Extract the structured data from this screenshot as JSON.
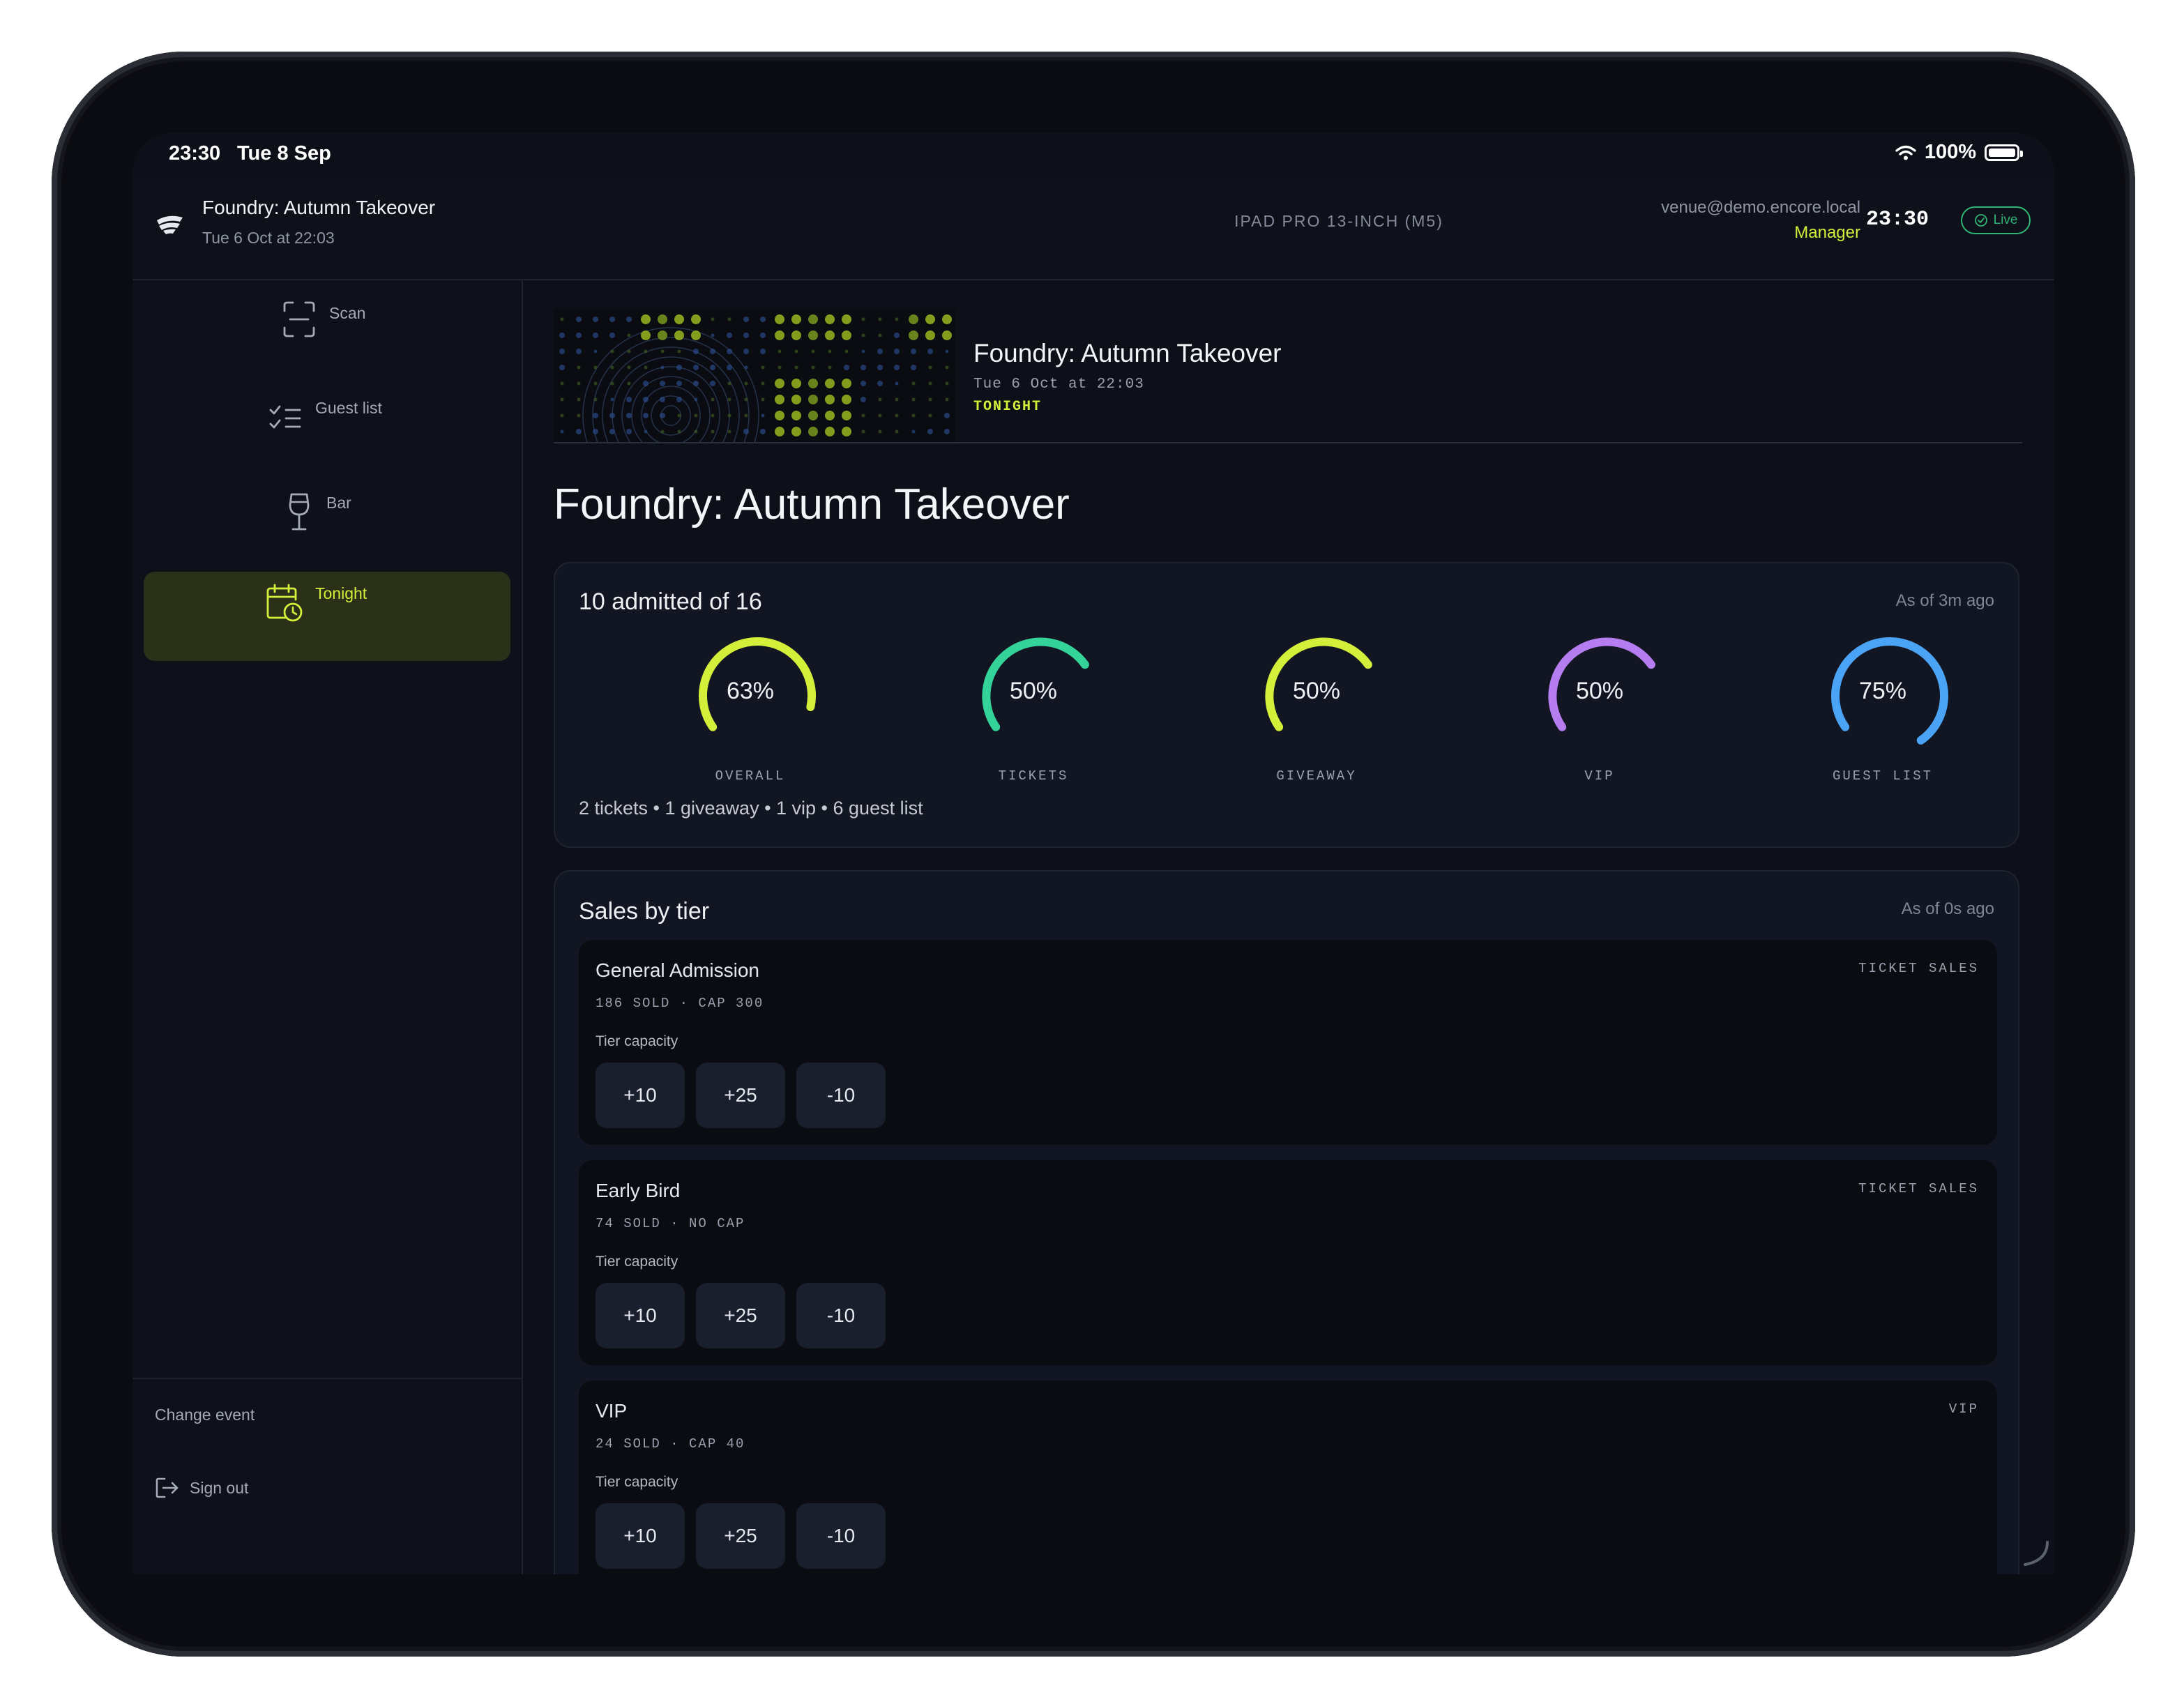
{
  "status_bar": {
    "time": "23:30",
    "date": "Tue 8 Sep",
    "battery": "100%"
  },
  "header": {
    "event_title": "Foundry: Autumn Takeover",
    "event_date": "Tue 6 Oct at 22:03",
    "device": "IPAD PRO 13-INCH (M5)",
    "user_email": "venue@demo.encore.local",
    "user_role": "Manager",
    "clock": "23:30",
    "live_label": "Live"
  },
  "sidebar": {
    "items": [
      {
        "label": "Scan",
        "icon": "scan-icon"
      },
      {
        "label": "Guest list",
        "icon": "checklist-icon"
      },
      {
        "label": "Bar",
        "icon": "wine-glass-icon"
      },
      {
        "label": "Tonight",
        "icon": "calendar-clock-icon",
        "active": true
      }
    ],
    "change_event": "Change event",
    "sign_out": "Sign out"
  },
  "banner": {
    "title": "Foundry: Autumn Takeover",
    "date": "Tue 6 Oct at 22:03",
    "tag": "TONIGHT"
  },
  "page_title": "Foundry: Autumn Takeover",
  "admissions": {
    "title": "10 admitted of 16",
    "as_of": "As of 3m ago",
    "rings": [
      {
        "label": "OVERALL",
        "percent": 63,
        "percent_text": "63%",
        "color": "#d4ef3a"
      },
      {
        "label": "TICKETS",
        "percent": 50,
        "percent_text": "50%",
        "color": "#34d399"
      },
      {
        "label": "GIVEAWAY",
        "percent": 50,
        "percent_text": "50%",
        "color": "#d4ef3a"
      },
      {
        "label": "VIP",
        "percent": 50,
        "percent_text": "50%",
        "color": "#b57df0"
      },
      {
        "label": "GUEST LIST",
        "percent": 75,
        "percent_text": "75%",
        "color": "#4aa3f5"
      }
    ],
    "breakdown": "2 tickets • 1 giveaway • 1 vip • 6 guest list"
  },
  "sales": {
    "title": "Sales by tier",
    "as_of": "As of 0s ago",
    "tiers": [
      {
        "name": "General Admission",
        "meta": "186 SOLD · CAP 300",
        "type": "TICKET SALES",
        "capacity_label": "Tier capacity",
        "buttons": [
          "+10",
          "+25",
          "-10"
        ]
      },
      {
        "name": "Early Bird",
        "meta": "74 SOLD · NO CAP",
        "type": "TICKET SALES",
        "capacity_label": "Tier capacity",
        "buttons": [
          "+10",
          "+25",
          "-10"
        ]
      },
      {
        "name": "VIP",
        "meta": "24 SOLD · CAP 40",
        "type": "VIP",
        "capacity_label": "Tier capacity",
        "buttons": [
          "+10",
          "+25",
          "-10"
        ]
      }
    ]
  },
  "colors": {
    "accent": "#d4ef3a",
    "live": "#2fb676",
    "background": "#0d1019"
  }
}
